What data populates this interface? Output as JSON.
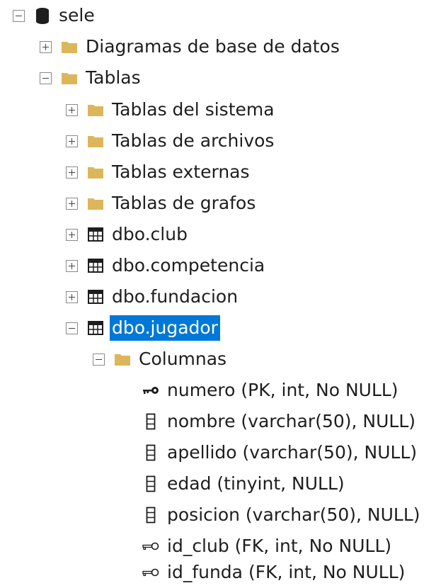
{
  "tree": {
    "database": {
      "label": "sele",
      "icon": "database-icon"
    },
    "diagrams": {
      "label": "Diagramas de base de datos",
      "icon": "folder-icon"
    },
    "tables": {
      "label": "Tablas",
      "icon": "folder-icon"
    },
    "system_tables": {
      "label": "Tablas del sistema",
      "icon": "folder-icon"
    },
    "file_tables": {
      "label": "Tablas de archivos",
      "icon": "folder-icon"
    },
    "external_tables": {
      "label": "Tablas externas",
      "icon": "folder-icon"
    },
    "graph_tables": {
      "label": "Tablas de grafos",
      "icon": "folder-icon"
    },
    "table_club": {
      "label": "dbo.club",
      "icon": "table-icon"
    },
    "table_competencia": {
      "label": "dbo.competencia",
      "icon": "table-icon"
    },
    "table_fundacion": {
      "label": "dbo.fundacion",
      "icon": "table-icon"
    },
    "table_jugador": {
      "label": "dbo.jugador",
      "icon": "table-icon",
      "selected": true
    },
    "columns_folder": {
      "label": "Columnas",
      "icon": "folder-icon"
    },
    "columns": [
      {
        "label": "numero (PK, int, No NULL)",
        "icon": "primary-key-icon"
      },
      {
        "label": "nombre (varchar(50), NULL)",
        "icon": "column-icon"
      },
      {
        "label": "apellido (varchar(50), NULL)",
        "icon": "column-icon"
      },
      {
        "label": "edad (tinyint, NULL)",
        "icon": "column-icon"
      },
      {
        "label": "posicion (varchar(50), NULL)",
        "icon": "column-icon"
      },
      {
        "label": "id_club (FK, int, No NULL)",
        "icon": "foreign-key-icon"
      },
      {
        "label": "id_funda (FK, int, No NULL)",
        "icon": "foreign-key-icon"
      }
    ]
  },
  "colors": {
    "selection": "#0078d7",
    "folder": "#dcb65b",
    "text": "#1e1e1e"
  }
}
